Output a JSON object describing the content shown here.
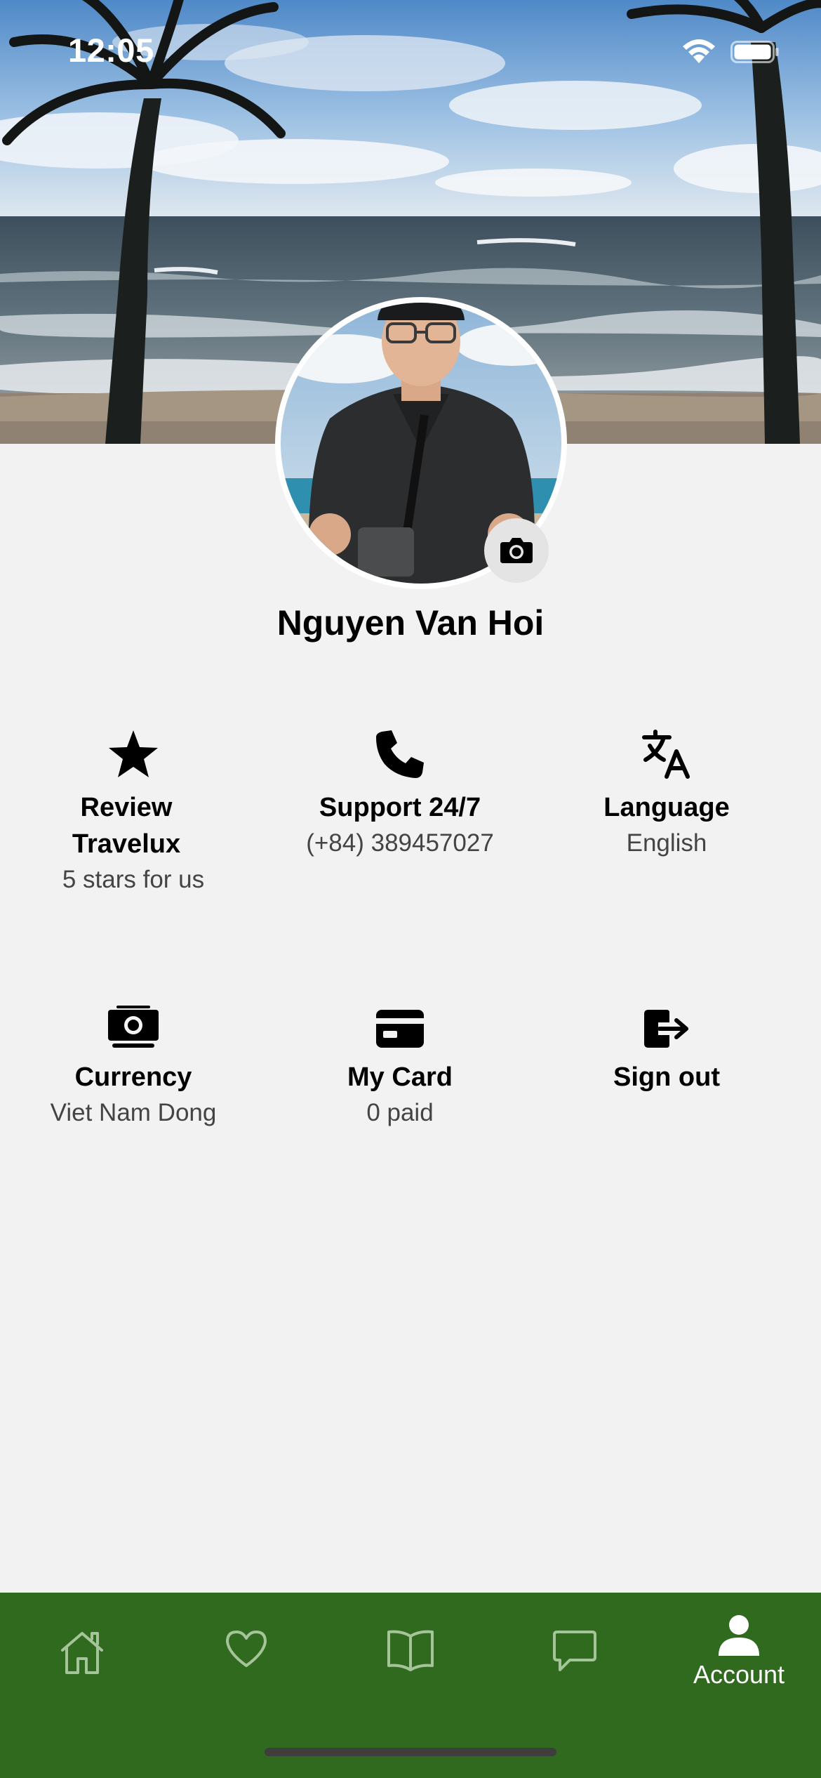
{
  "status_bar": {
    "time": "12:05"
  },
  "profile": {
    "name": "Nguyen Van Hoi"
  },
  "options": [
    {
      "title": "Review Travelux",
      "subtitle": "5 stars for us",
      "icon": "star-icon"
    },
    {
      "title": "Support 24/7",
      "subtitle": "(+84) 389457027",
      "icon": "phone-icon"
    },
    {
      "title": "Language",
      "subtitle": "English",
      "icon": "translate-icon"
    },
    {
      "title": "Currency",
      "subtitle": "Viet Nam Dong",
      "icon": "money-icon"
    },
    {
      "title": "My Card",
      "subtitle": "0 paid",
      "icon": "credit-card-icon"
    },
    {
      "title": "Sign out",
      "subtitle": "",
      "icon": "sign-out-icon"
    }
  ],
  "tab_bar": {
    "tabs": [
      {
        "icon": "home-icon",
        "label": ""
      },
      {
        "icon": "heart-icon",
        "label": ""
      },
      {
        "icon": "book-icon",
        "label": ""
      },
      {
        "icon": "chat-icon",
        "label": ""
      },
      {
        "icon": "account-icon",
        "label": "Account",
        "active": true
      }
    ]
  },
  "colors": {
    "background": "#f2f2f2",
    "tab_bar": "#306a1f",
    "tab_inactive": "#a6c49a",
    "tab_active": "#ffffff"
  }
}
